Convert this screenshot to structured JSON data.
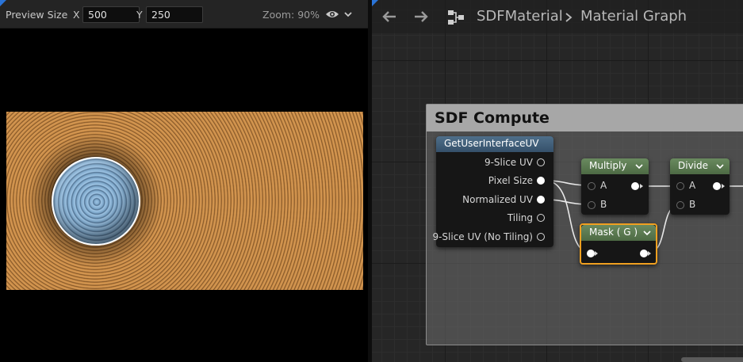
{
  "preview_toolbar": {
    "preview_size_label": "Preview Size",
    "x_label": "X",
    "x_value": "500",
    "y_label": "Y",
    "y_value": "250",
    "zoom_text": "Zoom: 90%",
    "visibility_icon": "eye-icon",
    "dropdown_icon": "chevron-down-icon"
  },
  "graph_header": {
    "back_icon": "arrow-left-icon",
    "forward_icon": "arrow-right-icon",
    "graph_icon": "graph-hierarchy-icon",
    "breadcrumb": [
      "SDFMaterial",
      "Material Graph"
    ]
  },
  "comment_box": {
    "title": "SDF Compute"
  },
  "nodes": {
    "get_uv": {
      "title": "GetUserInterfaceUV",
      "outputs": [
        "9-Slice UV",
        "Pixel Size",
        "Normalized UV",
        "Tiling",
        "9-Slice UV (No Tiling)"
      ]
    },
    "multiply": {
      "title": "Multiply",
      "inputs": [
        "A",
        "B"
      ]
    },
    "divide": {
      "title": "Divide",
      "inputs": [
        "A",
        "B"
      ]
    },
    "mask": {
      "title": "Mask ( G )"
    }
  },
  "colors": {
    "accent_blue": "#2a74d8",
    "selected_outline": "#f0a020",
    "preview_orange": "#c78a45",
    "sphere_blue": "#8fb7da"
  }
}
